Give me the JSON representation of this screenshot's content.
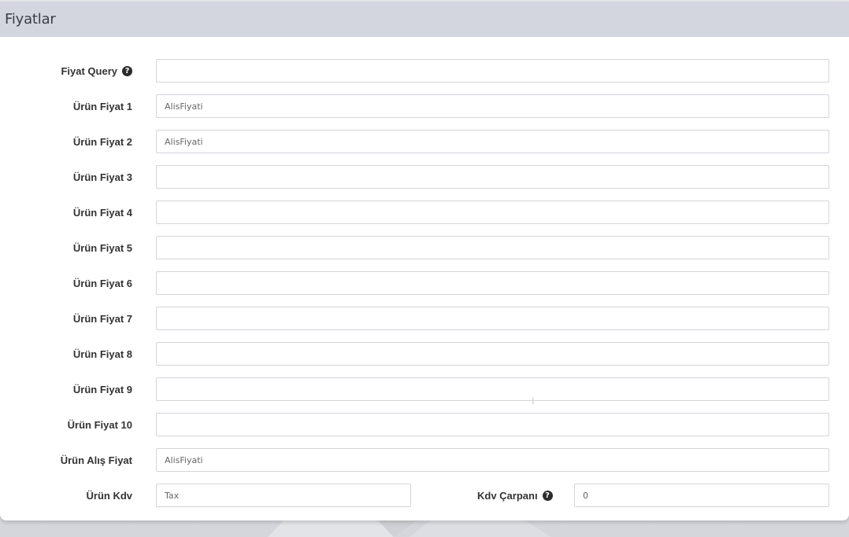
{
  "panel": {
    "title": "Fiyatlar"
  },
  "fields": [
    {
      "label": "Fiyat Query",
      "value": "",
      "placeholder": "",
      "help": true
    },
    {
      "label": "Ürün Fiyat 1",
      "value": "AlisFiyati",
      "placeholder": "",
      "help": false
    },
    {
      "label": "Ürün Fiyat 2",
      "value": "AlisFiyati",
      "placeholder": "",
      "help": false
    },
    {
      "label": "Ürün Fiyat 3",
      "value": "",
      "placeholder": "",
      "help": false
    },
    {
      "label": "Ürün Fiyat 4",
      "value": "",
      "placeholder": "",
      "help": false
    },
    {
      "label": "Ürün Fiyat 5",
      "value": "",
      "placeholder": "",
      "help": false
    },
    {
      "label": "Ürün Fiyat 6",
      "value": "",
      "placeholder": "",
      "help": false
    },
    {
      "label": "Ürün Fiyat 7",
      "value": "",
      "placeholder": "",
      "help": false
    },
    {
      "label": "Ürün Fiyat 8",
      "value": "",
      "placeholder": "",
      "help": false
    },
    {
      "label": "Ürün Fiyat 9",
      "value": "",
      "placeholder": "",
      "help": false
    },
    {
      "label": "Ürün Fiyat 10",
      "value": "",
      "placeholder": "",
      "help": false
    },
    {
      "label": "Ürün Alış Fiyat",
      "value": "AlisFiyati",
      "placeholder": "",
      "help": false
    }
  ],
  "kdv": {
    "label": "Ürün Kdv",
    "value": "Tax",
    "carpani_label": "Kdv Çarpanı",
    "carpani_value": "0"
  },
  "icons": {
    "help": "question-circle-icon"
  },
  "colors": {
    "header_bg": "#d3d6de",
    "panel_bg": "#ffffff",
    "input_border": "#d2d5da",
    "label_text": "#333333"
  }
}
